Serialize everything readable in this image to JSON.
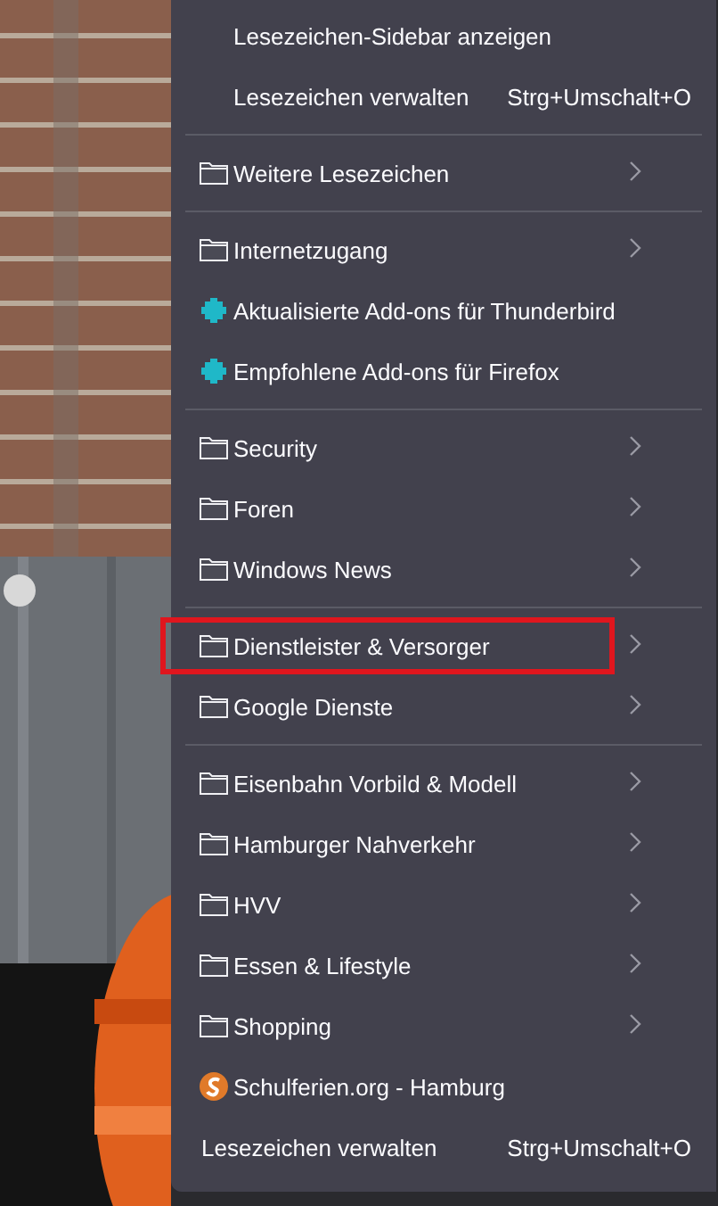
{
  "menu": {
    "sections": [
      {
        "items": [
          {
            "kind": "action",
            "label": "Lesezeichen-Sidebar anzeigen",
            "marked": false
          },
          {
            "kind": "action",
            "label": "Lesezeichen verwalten",
            "shortcut": "Strg+Umschalt+O",
            "marked": false
          }
        ]
      },
      {
        "items": [
          {
            "kind": "folder",
            "label": "Weitere Lesezeichen",
            "marked": false
          }
        ]
      },
      {
        "items": [
          {
            "kind": "folder",
            "label": "Internetzugang",
            "marked": false
          },
          {
            "kind": "addon",
            "label": "Aktualisierte Add-ons für Thunderbird",
            "marked": false
          },
          {
            "kind": "addon",
            "label": "Empfohlene Add-ons für Firefox",
            "marked": false
          }
        ]
      },
      {
        "items": [
          {
            "kind": "folder",
            "label": "Security",
            "marked": false
          },
          {
            "kind": "folder",
            "label": "Foren",
            "marked": false
          },
          {
            "kind": "folder",
            "label": "Windows News",
            "marked": false
          }
        ]
      },
      {
        "items": [
          {
            "kind": "folder",
            "label": "Dienstleister & Versorger",
            "marked": true
          },
          {
            "kind": "folder",
            "label": "Google Dienste",
            "marked": false
          }
        ]
      },
      {
        "items": [
          {
            "kind": "folder",
            "label": "Eisenbahn Vorbild & Modell",
            "marked": false
          },
          {
            "kind": "folder",
            "label": "Hamburger Nahverkehr",
            "marked": false
          },
          {
            "kind": "folder",
            "label": "HVV",
            "marked": false
          },
          {
            "kind": "folder",
            "label": "Essen & Lifestyle",
            "marked": false
          },
          {
            "kind": "folder",
            "label": "Shopping",
            "marked": false
          },
          {
            "kind": "site",
            "label": "Schulferien.org - Hamburg",
            "marked": false
          },
          {
            "kind": "footer",
            "label": "Lesezeichen verwalten",
            "shortcut": "Strg+Umschalt+O",
            "marked": false
          }
        ]
      }
    ]
  }
}
